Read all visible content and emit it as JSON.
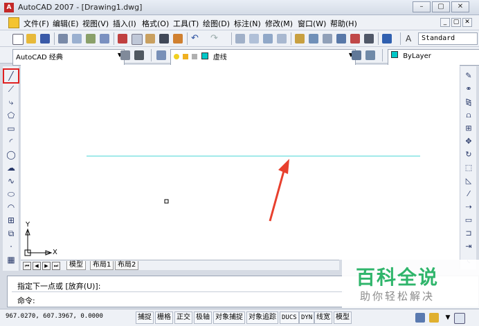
{
  "window": {
    "title": "AutoCAD 2007 - [Drawing1.dwg]",
    "controls": [
      "–",
      "▢",
      "✕"
    ]
  },
  "menu": {
    "items": [
      "文件(F)",
      "编辑(E)",
      "视图(V)",
      "插入(I)",
      "格式(O)",
      "工具(T)",
      "绘图(D)",
      "标注(N)",
      "修改(M)",
      "窗口(W)",
      "帮助(H)"
    ],
    "mdi_controls": [
      "_",
      "▢",
      "✕"
    ]
  },
  "toolbar": {
    "text_style": "Standard",
    "workspace": "AutoCAD 经典",
    "layer": "虚线",
    "color": "ByLayer"
  },
  "canvas": {
    "line_color": "#44d4d4",
    "arrow_color": "#e8402e",
    "ucs_y_label": "Y",
    "ucs_x_label": "X"
  },
  "tabs": {
    "items": [
      "模型",
      "布局1",
      "布局2"
    ],
    "nav": [
      "⏮",
      "◀",
      "▶",
      "⏭"
    ]
  },
  "command": {
    "line1": "指定下一点或 [放弃(U)]:",
    "line2": "命令:"
  },
  "status": {
    "coords": "967.0270, 607.3967, 0.0000",
    "buttons": [
      "捕捉",
      "栅格",
      "正交",
      "极轴",
      "对象捕捉",
      "对象追踪",
      "DUCS",
      "DYN",
      "线宽",
      "模型"
    ]
  },
  "watermark": {
    "title": "百科全说",
    "subtitle": "助你轻松解决"
  },
  "colors": {
    "highlight": "#e02020"
  }
}
